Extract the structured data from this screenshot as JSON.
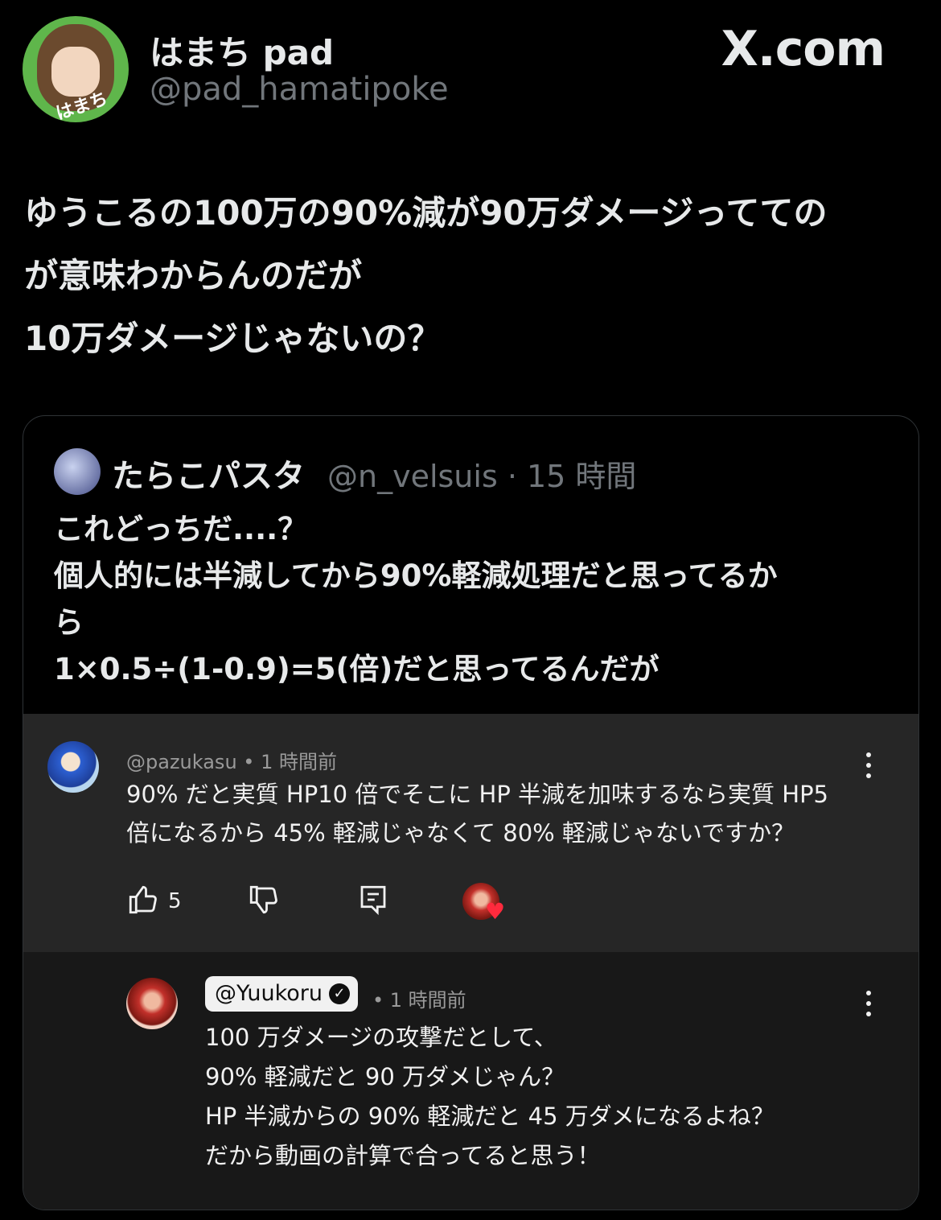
{
  "tweet": {
    "author_name": "はまち pad",
    "author_handle": "@pad_hamatipoke",
    "avatar_tag": "はまち",
    "site": "X.com",
    "text_lines": [
      "ゆうこるの100万の90%減が90万ダメージってての",
      "が意味わからんのだが",
      "10万ダメージじゃないの？"
    ]
  },
  "quote": {
    "name": "たらこパスタ",
    "handle_time": "@n_velsuis · 15 時間",
    "text_lines": [
      "これどっちだ....？",
      "個人的には半減してから90%軽減処理だと思ってるか",
      "ら",
      "1×0.5÷(1-0.9)=5(倍)だと思ってるんだが"
    ]
  },
  "comment1": {
    "meta": "@pazukasu • 1 時間前",
    "lines": [
      "90% だと実質 HP10 倍でそこに HP 半減を加味するなら実質 HP5",
      "倍になるから 45% 軽減じゃなくて 80% 軽減じゃないですか？"
    ],
    "likes": "5"
  },
  "comment2": {
    "handle": "@Yuukoru",
    "time": "• 1 時間前",
    "lines": [
      "100 万ダメージの攻撃だとして、",
      "90% 軽減だと 90 万ダメじゃん？",
      "HP 半減からの 90% 軽減だと 45 万ダメになるよね？",
      "だから動画の計算で合ってると思う！"
    ]
  },
  "icons": [
    "like-icon",
    "dislike-icon",
    "reply-icon",
    "heart-icon",
    "verified-icon",
    "more-icon"
  ]
}
